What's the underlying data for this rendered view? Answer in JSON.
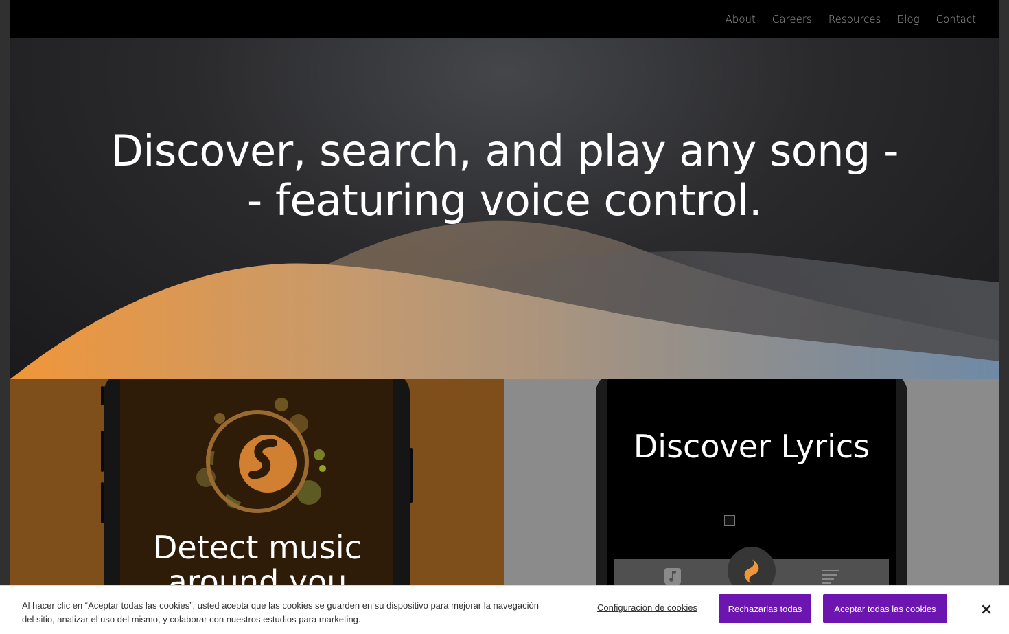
{
  "nav": {
    "links": [
      "About",
      "Careers",
      "Resources",
      "Blog",
      "Contact"
    ]
  },
  "hero": {
    "title": "Discover, search, and play any song -- featuring voice control."
  },
  "panels": {
    "detect_title": "Detect music around you",
    "lyrics_title": "Discover Lyrics"
  },
  "icons": {
    "logo": "shazam-logo-icon",
    "tab_left": "music-note-icon",
    "tab_center": "shazam-icon",
    "tab_right": "list-icon",
    "close": "close-icon",
    "broken_image": "broken-image-icon"
  },
  "colors": {
    "accent_orange": "#f0963a",
    "panel_orange": "#7e4f1b",
    "cookie_button": "#6c15b0"
  },
  "cookie": {
    "text": "Al hacer clic en “Aceptar todas las cookies”, usted acepta que las cookies se guarden en su dispositivo para mejorar la navegación del sitio, analizar el uso del mismo, y colaborar con nuestros estudios para marketing.",
    "settings_label": "Configuración de cookies",
    "reject_label": "Rechazarlas todas",
    "accept_label": "Aceptar todas las cookies",
    "close_label": "×"
  }
}
